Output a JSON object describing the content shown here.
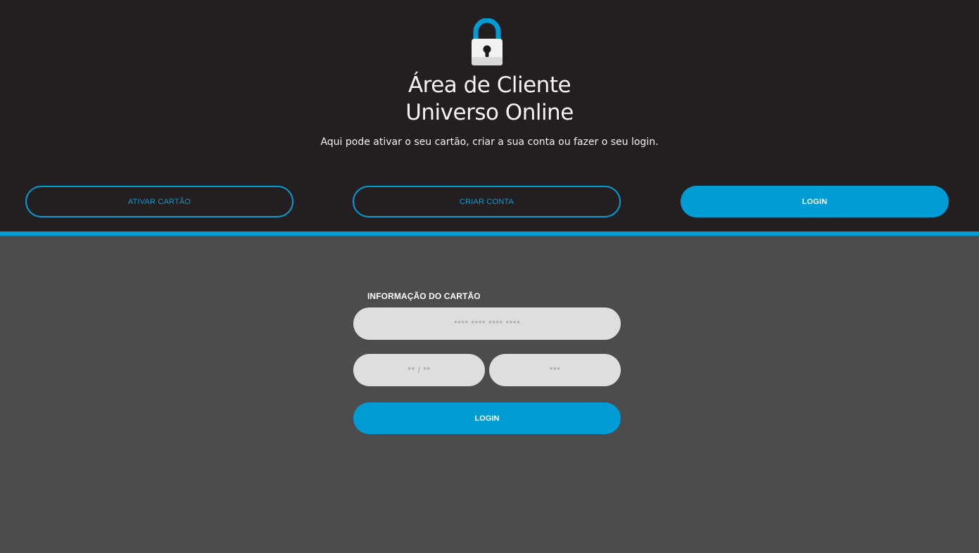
{
  "header": {
    "icon": "lock-icon",
    "title_line1": "Área de Cliente",
    "title_line2": "Universo Online",
    "subtitle": "Aqui pode ativar o seu cartão, criar a sua conta ou fazer o seu login."
  },
  "tabs": [
    {
      "label": "ATIVAR CARTÃO",
      "active": false
    },
    {
      "label": "CRIAR CONTA",
      "active": false
    },
    {
      "label": "LOGIN",
      "active": true
    }
  ],
  "form": {
    "section_label": "INFORMAÇÃO DO CARTÃO",
    "card_number": {
      "value": "",
      "placeholder": "**** **** **** ****"
    },
    "expiry": {
      "value": "",
      "placeholder": "** / **"
    },
    "cvv": {
      "value": "",
      "placeholder": "***"
    },
    "submit_label": "LOGIN"
  },
  "colors": {
    "accent": "#009cd6",
    "header_bg": "#231f20",
    "body_bg": "#4c4c4c",
    "input_bg": "#dedede"
  }
}
